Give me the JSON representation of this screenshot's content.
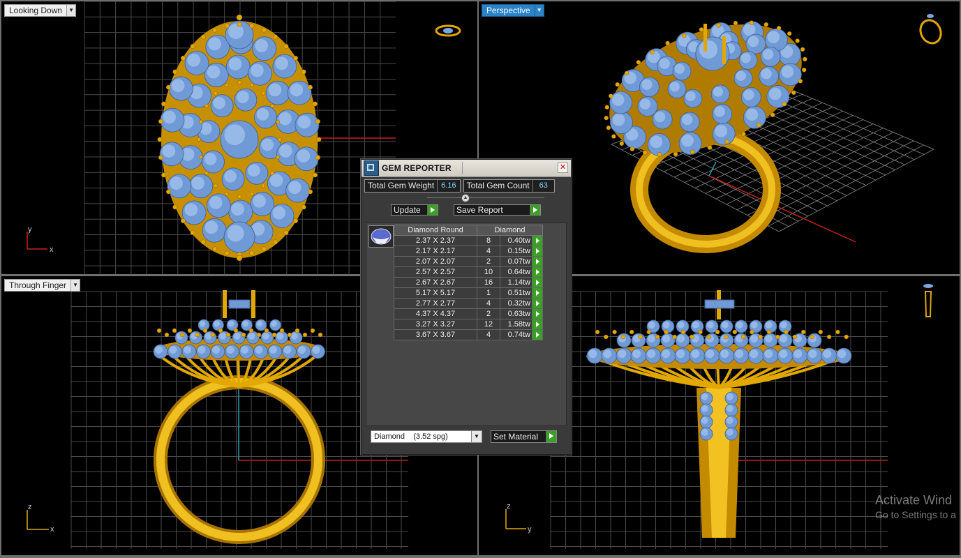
{
  "viewports": {
    "top_left": {
      "label": "Looking Down",
      "axis1": "y",
      "axis2": "x"
    },
    "top_right": {
      "label": "Perspective"
    },
    "bottom_left": {
      "label": "Through Finger",
      "axis1": "z",
      "axis2": "x"
    },
    "bottom_right": {
      "axis1": "z",
      "axis2": "y"
    }
  },
  "gem_reporter": {
    "title": "GEM REPORTER",
    "total_weight_label": "Total Gem Weight",
    "total_weight_value": "6.16",
    "total_count_label": "Total Gem Count",
    "total_count_value": "63",
    "update_label": "Update",
    "save_report_label": "Save Report",
    "table_headers": {
      "shape": "Diamond Round",
      "material": "Diamond"
    },
    "rows": [
      {
        "size": "2.37 X 2.37",
        "count": "8",
        "weight": "0.40tw"
      },
      {
        "size": "2.17 X 2.17",
        "count": "4",
        "weight": "0.15tw"
      },
      {
        "size": "2.07 X 2.07",
        "count": "2",
        "weight": "0.07tw"
      },
      {
        "size": "2.57 X 2.57",
        "count": "10",
        "weight": "0.64tw"
      },
      {
        "size": "2.67 X 2.67",
        "count": "16",
        "weight": "1.14tw"
      },
      {
        "size": "5.17 X 5.17",
        "count": "1",
        "weight": "0.51tw"
      },
      {
        "size": "2.77 X 2.77",
        "count": "4",
        "weight": "0.32tw"
      },
      {
        "size": "4.37 X 4.37",
        "count": "2",
        "weight": "0.63tw"
      },
      {
        "size": "3.27 X 3.27",
        "count": "12",
        "weight": "1.58tw"
      },
      {
        "size": "3.67 X 3.67",
        "count": "4",
        "weight": "0.74tw"
      }
    ],
    "material_select": "Diamond    (3.52 spg)",
    "set_material_label": "Set Material"
  },
  "watermark": {
    "line1": "Activate Wind",
    "line2": "Go to Settings to a"
  },
  "colors": {
    "gold": "#e2a800",
    "gem": "#7aa7e0",
    "grid": "#4a4a4a",
    "axis_red": "#c8201c",
    "axis_cyan": "#2a9fb0",
    "accent": "#2b83c7"
  }
}
